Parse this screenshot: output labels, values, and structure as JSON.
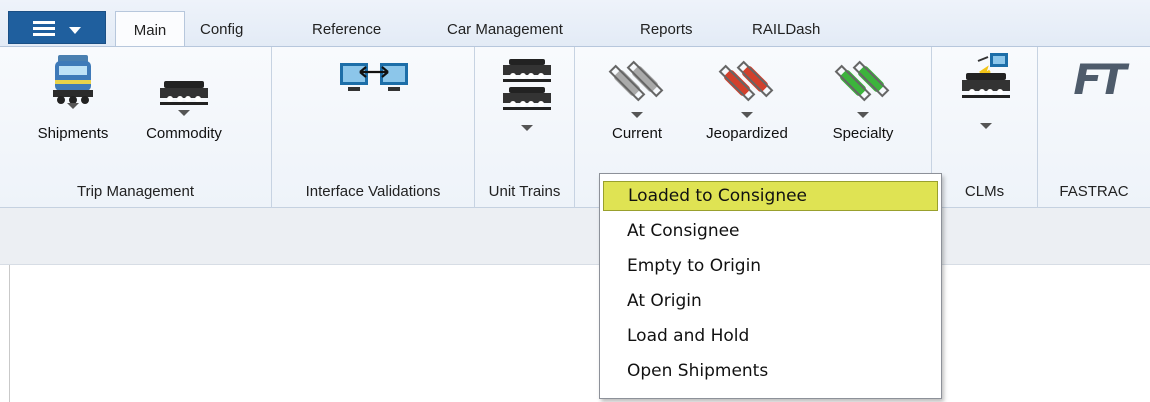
{
  "app_menu": {
    "icon": "hamburger-menu-icon",
    "caret": "chevron-down-icon"
  },
  "tabs": [
    {
      "label": "Main",
      "active": true
    },
    {
      "label": "Config"
    },
    {
      "label": "Reference"
    },
    {
      "label": "Car Management"
    },
    {
      "label": "Reports"
    },
    {
      "label": "RAILDash"
    }
  ],
  "ribbon": {
    "trip_management": {
      "label": "Trip Management",
      "buttons": [
        {
          "label": "Shipments",
          "icon": "locomotive-icon"
        },
        {
          "label": "Commodity",
          "icon": "railcar-icon"
        }
      ]
    },
    "interface_validations": {
      "label": "Interface Validations",
      "icon": "monitors-transfer-icon"
    },
    "unit_trains": {
      "label": "Unit Trains",
      "icon": "stacked-railcars-icon"
    },
    "status": {
      "buttons": [
        {
          "label": "Current",
          "icon": "gray-fuses-icon"
        },
        {
          "label": "Jeopardized",
          "icon": "red-fuses-icon"
        },
        {
          "label": "Specialty",
          "icon": "green-fuses-icon"
        }
      ]
    },
    "clms": {
      "label": "CLMs",
      "icon": "railcar-signal-icon"
    },
    "fastrac": {
      "label": "FASTRAC",
      "logo_text": "FT"
    }
  },
  "dropdown_menu": {
    "items": [
      {
        "label": "Loaded to Consignee",
        "highlighted": true
      },
      {
        "label": "At Consignee"
      },
      {
        "label": "Empty to Origin"
      },
      {
        "label": "At Origin"
      },
      {
        "label": "Load and Hold"
      },
      {
        "label": "Open Shipments"
      }
    ]
  },
  "colors": {
    "app_button": "#1f5f9e",
    "highlight": "#dfe353",
    "fuse_red": "#d2402c",
    "fuse_green": "#3cb43c"
  }
}
